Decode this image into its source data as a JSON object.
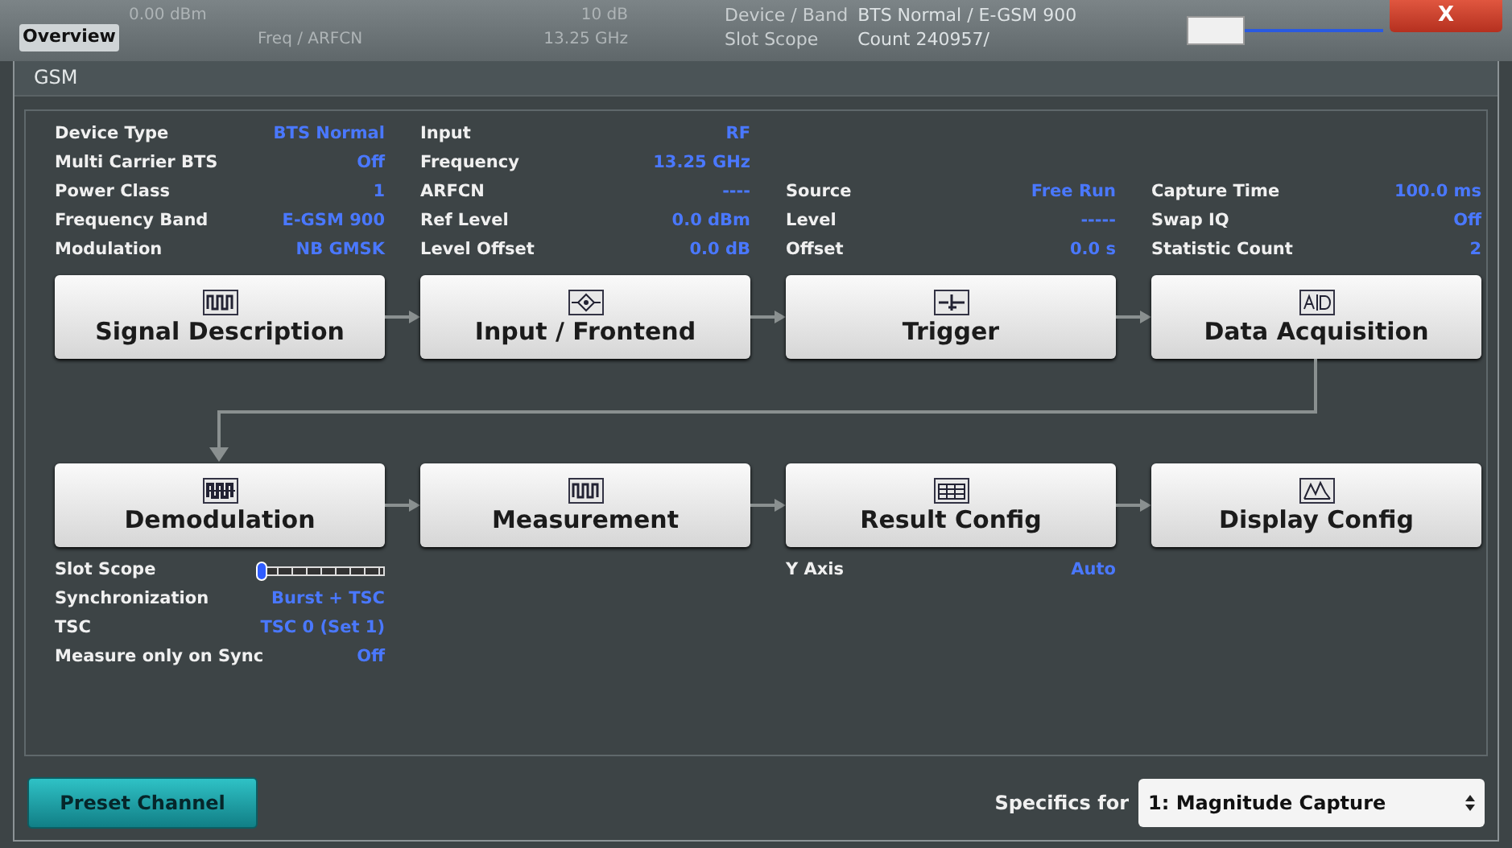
{
  "header": {
    "texts": [
      {
        "kind": "left",
        "text": "0.00 dBm"
      },
      {
        "kind": "left",
        "text": "10 dB"
      },
      {
        "kind": "left",
        "text": "Freq / ARFCN"
      },
      {
        "kind": "left",
        "text": "13.25 GHz"
      },
      {
        "kind": "right",
        "text": "Device / Band"
      },
      {
        "kind": "right",
        "text": "BTS Normal / E-GSM 900"
      },
      {
        "kind": "right",
        "text": "Slot Scope"
      },
      {
        "kind": "right",
        "text": "Count 240957/"
      }
    ]
  },
  "window": {
    "title": "Overview",
    "close": "X"
  },
  "panel": {
    "title": "GSM"
  },
  "top_info": [
    [
      {
        "label": "Device Type",
        "value": "BTS Normal"
      },
      {
        "label": "Multi Carrier BTS",
        "value": "Off"
      },
      {
        "label": "Power Class",
        "value": "1"
      },
      {
        "label": "Frequency Band",
        "value": "E-GSM 900"
      },
      {
        "label": "Modulation",
        "value": "NB GMSK"
      }
    ],
    [
      {
        "label": "Input",
        "value": "RF"
      },
      {
        "label": "Frequency",
        "value": "13.25 GHz"
      },
      {
        "label": "ARFCN",
        "value": "----"
      },
      {
        "label": "Ref Level",
        "value": "0.0 dBm"
      },
      {
        "label": "Level Offset",
        "value": "0.0 dB"
      }
    ],
    [
      {
        "label": "Source",
        "value": "Free Run"
      },
      {
        "label": "Level",
        "value": "-----"
      },
      {
        "label": "Offset",
        "value": "0.0 s"
      }
    ],
    [
      {
        "label": "Capture Time",
        "value": "100.0 ms"
      },
      {
        "label": "Swap IQ",
        "value": "Off"
      },
      {
        "label": "Statistic Count",
        "value": "2"
      }
    ]
  ],
  "blocks_row1": [
    {
      "label": "Signal Description",
      "kind": "pulse"
    },
    {
      "label": "Input / Frontend",
      "kind": "diamond"
    },
    {
      "label": "Trigger",
      "kind": "trigger"
    },
    {
      "label": "Data Acquisition",
      "kind": "ad"
    }
  ],
  "blocks_row2": [
    {
      "label": "Demodulation",
      "kind": "demod"
    },
    {
      "label": "Measurement",
      "kind": "pulse"
    },
    {
      "label": "Result Config",
      "kind": "table"
    },
    {
      "label": "Display Config",
      "kind": "display"
    }
  ],
  "demodulation_info": [
    {
      "kind": "slider",
      "label": "Slot Scope",
      "level": 0
    },
    {
      "kind": "text",
      "label": "Synchronization",
      "value": "Burst + TSC"
    },
    {
      "kind": "text",
      "label": "TSC",
      "value": "TSC 0 (Set 1)"
    },
    {
      "kind": "text",
      "label": "Measure only on Sync",
      "value": "Off"
    }
  ],
  "result_config_info": [
    {
      "label": "Y Axis",
      "value": "Auto"
    }
  ],
  "zoom_slider": {
    "level": 0
  },
  "footer": {
    "preset": "Preset Channel",
    "specifics_label": "Specifics for",
    "specifics_value": "1: Magnitude Capture"
  }
}
